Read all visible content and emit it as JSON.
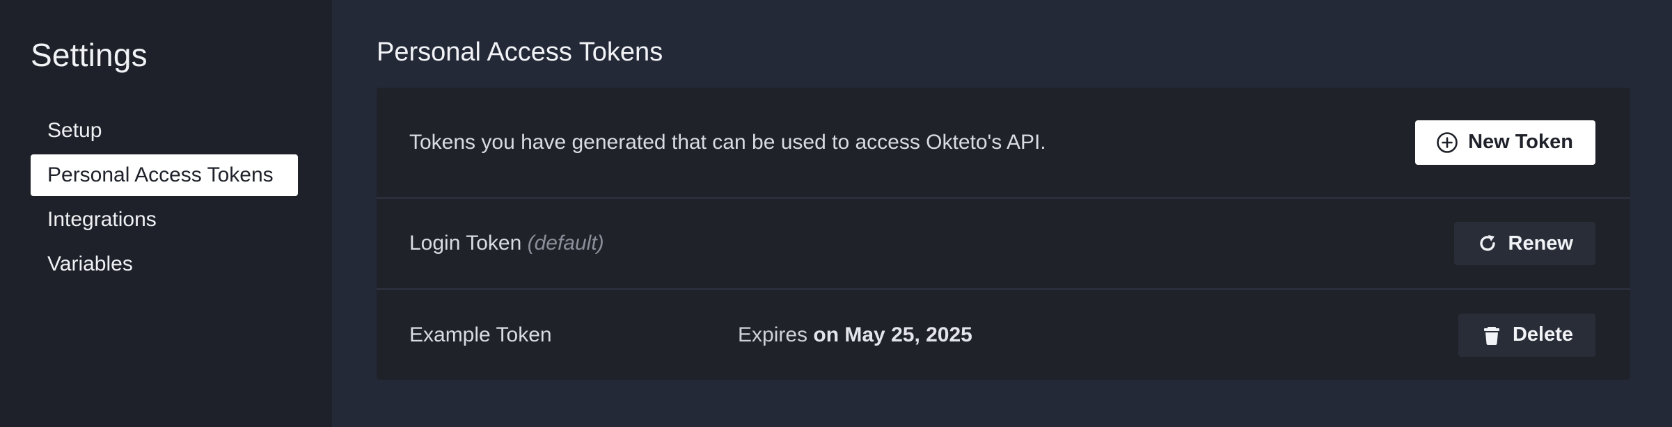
{
  "sidebar": {
    "title": "Settings",
    "items": [
      {
        "label": "Setup",
        "active": false
      },
      {
        "label": "Personal Access Tokens",
        "active": true
      },
      {
        "label": "Integrations",
        "active": false
      },
      {
        "label": "Variables",
        "active": false
      }
    ]
  },
  "main": {
    "title": "Personal Access Tokens",
    "description": "Tokens you have generated that can be used to access Okteto's API.",
    "new_token_label": "New Token",
    "new_token_icon": "plus-circle-icon",
    "tokens": [
      {
        "name": "Login Token",
        "note": "(default)",
        "action_label": "Renew",
        "action_icon": "refresh-icon"
      },
      {
        "name": "Example Token",
        "expires_prefix": "Expires",
        "expires_date": "on May 25, 2025",
        "action_label": "Delete",
        "action_icon": "trash-icon"
      }
    ]
  },
  "colors": {
    "sidebar_bg": "#1e2129",
    "main_bg": "#242938",
    "card_bg": "#1f2229",
    "primary_button_bg": "#ffffff",
    "secondary_button_bg": "#292d38"
  }
}
